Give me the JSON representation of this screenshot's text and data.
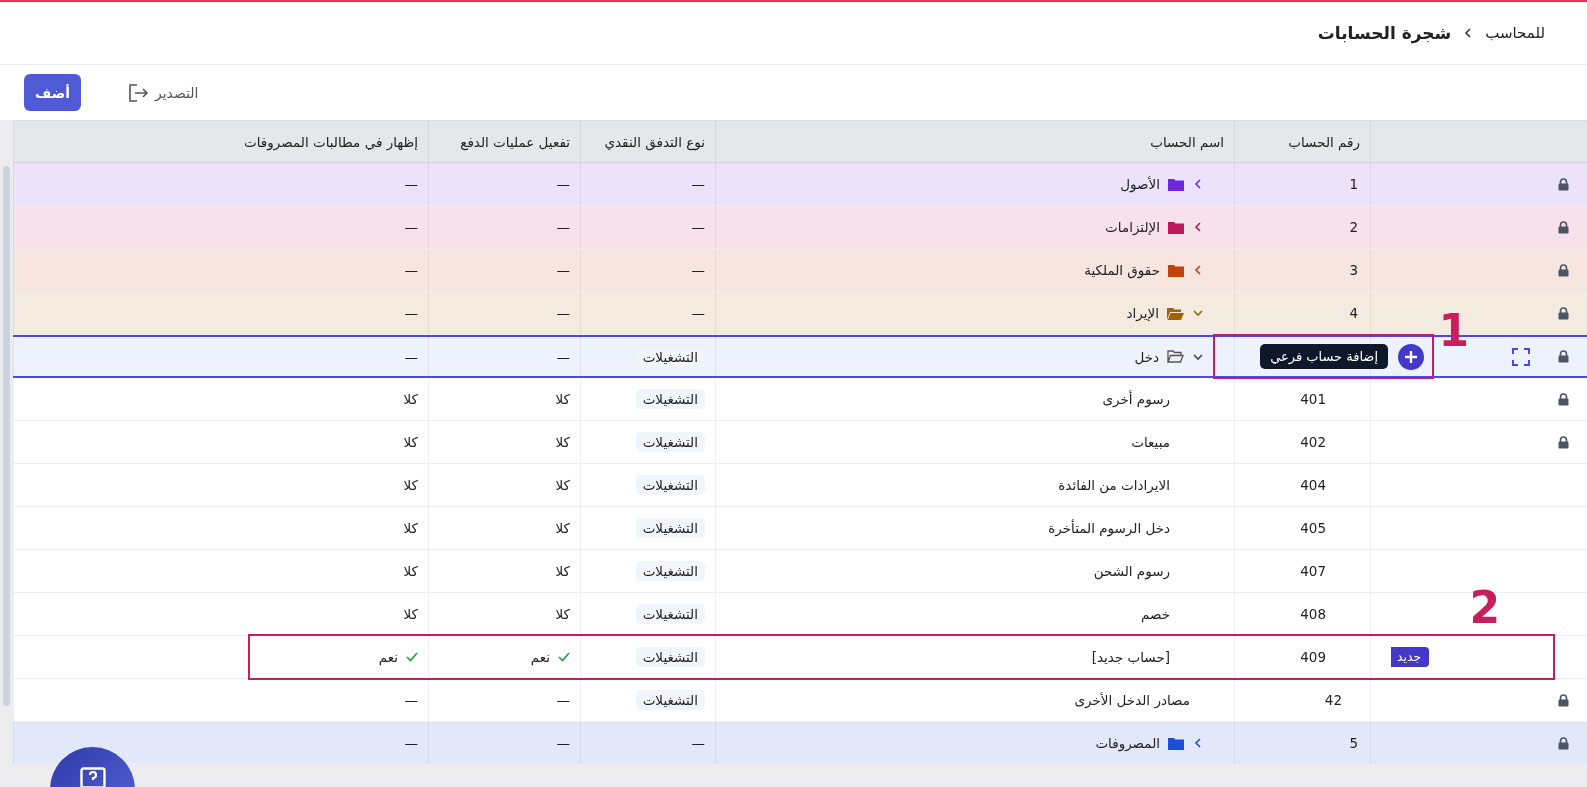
{
  "breadcrumb": {
    "parent": "للمحاسب",
    "current": "شجرة الحسابات"
  },
  "toolbar": {
    "export_label": "التصدير",
    "add_label": "أضف"
  },
  "table": {
    "columns": [
      "رقم الحساب",
      "اسم الحساب",
      "نوع التدفق النقدي",
      "تفعيل عمليات الدفع",
      "إظهار في مطالبات المصروفات"
    ],
    "rows": [
      {
        "kind": "group",
        "locked": true,
        "number": "1",
        "name": "الأصول",
        "color": "#6d28d9",
        "expanded": false,
        "selected": false,
        "cash_flow": {
          "text": "—",
          "tag": false
        },
        "payments": {
          "text": "—",
          "checked": false
        },
        "expense_claims": {
          "text": "—",
          "checked": false
        }
      },
      {
        "kind": "group",
        "locked": true,
        "number": "2",
        "name": "الإلتزامات",
        "color": "#be185d",
        "expanded": false,
        "selected": false,
        "cash_flow": {
          "text": "—",
          "tag": false
        },
        "payments": {
          "text": "—",
          "checked": false
        },
        "expense_claims": {
          "text": "—",
          "checked": false
        }
      },
      {
        "kind": "group",
        "locked": true,
        "number": "3",
        "name": "حقوق الملكية",
        "color": "#c2410c",
        "expanded": false,
        "selected": false,
        "cash_flow": {
          "text": "—",
          "tag": false
        },
        "payments": {
          "text": "—",
          "checked": false
        },
        "expense_claims": {
          "text": "—",
          "checked": false
        }
      },
      {
        "kind": "group",
        "locked": true,
        "number": "4",
        "name": "الإيراد",
        "color": "#a16207",
        "expanded": true,
        "selected": false,
        "cash_flow": {
          "text": "—",
          "tag": false
        },
        "payments": {
          "text": "—",
          "checked": false
        },
        "expense_claims": {
          "text": "—",
          "checked": false
        },
        "children": [
          {
            "kind": "folder",
            "locked": true,
            "name": "دخل",
            "expanded": true,
            "selected": true,
            "tooltip": "إضافة حساب فرعي",
            "callout": "1",
            "cash_flow": {
              "text": "التشغيلات",
              "tag": true
            },
            "payments": {
              "text": "—",
              "checked": false
            },
            "expense_claims": {
              "text": "—",
              "checked": false
            },
            "children": [
              {
                "kind": "account",
                "locked": true,
                "number": "401",
                "name": "رسوم أخرى",
                "selected": false,
                "cash_flow": {
                  "text": "التشغيلات",
                  "tag": true
                },
                "payments": {
                  "text": "كلا",
                  "checked": false
                },
                "expense_claims": {
                  "text": "كلا",
                  "checked": false
                }
              },
              {
                "kind": "account",
                "locked": true,
                "number": "402",
                "name": "مبيعات",
                "selected": false,
                "cash_flow": {
                  "text": "التشغيلات",
                  "tag": true
                },
                "payments": {
                  "text": "كلا",
                  "checked": false
                },
                "expense_claims": {
                  "text": "كلا",
                  "checked": false
                }
              },
              {
                "kind": "account",
                "locked": false,
                "number": "404",
                "name": "الايرادات من الفائدة",
                "selected": false,
                "cash_flow": {
                  "text": "التشغيلات",
                  "tag": true
                },
                "payments": {
                  "text": "كلا",
                  "checked": false
                },
                "expense_claims": {
                  "text": "كلا",
                  "checked": false
                }
              },
              {
                "kind": "account",
                "locked": false,
                "number": "405",
                "name": "دخل الرسوم المتأخرة",
                "selected": false,
                "cash_flow": {
                  "text": "التشغيلات",
                  "tag": true
                },
                "payments": {
                  "text": "كلا",
                  "checked": false
                },
                "expense_claims": {
                  "text": "كلا",
                  "checked": false
                }
              },
              {
                "kind": "account",
                "locked": false,
                "number": "407",
                "name": "رسوم الشحن",
                "selected": false,
                "cash_flow": {
                  "text": "التشغيلات",
                  "tag": true
                },
                "payments": {
                  "text": "كلا",
                  "checked": false
                },
                "expense_claims": {
                  "text": "كلا",
                  "checked": false
                }
              },
              {
                "kind": "account",
                "locked": false,
                "number": "408",
                "name": "خصم",
                "selected": false,
                "cash_flow": {
                  "text": "التشغيلات",
                  "tag": true
                },
                "payments": {
                  "text": "كلا",
                  "checked": false
                },
                "expense_claims": {
                  "text": "كلا",
                  "checked": false
                }
              },
              {
                "kind": "account",
                "locked": false,
                "number": "409",
                "name": "[حساب جديد]",
                "badge": "جديد",
                "callout": "2",
                "selected": false,
                "cash_flow": {
                  "text": "التشغيلات",
                  "tag": true
                },
                "payments": {
                  "text": "نعم",
                  "checked": true
                },
                "expense_claims": {
                  "text": "نعم",
                  "checked": true
                }
              }
            ]
          },
          {
            "kind": "account",
            "locked": true,
            "number": "42",
            "name": "مصادر الدخل الأخرى",
            "selected": false,
            "cash_flow": {
              "text": "التشغيلات",
              "tag": true
            },
            "payments": {
              "text": "—",
              "checked": false
            },
            "expense_claims": {
              "text": "—",
              "checked": false
            }
          }
        ]
      },
      {
        "kind": "group",
        "locked": true,
        "number": "5",
        "name": "المصروفات",
        "color": "#1d4ed8",
        "expanded": false,
        "selected": false,
        "cash_flow": {
          "text": "—",
          "tag": false
        },
        "payments": {
          "text": "—",
          "checked": false
        },
        "expense_claims": {
          "text": "—",
          "checked": false
        }
      }
    ]
  }
}
